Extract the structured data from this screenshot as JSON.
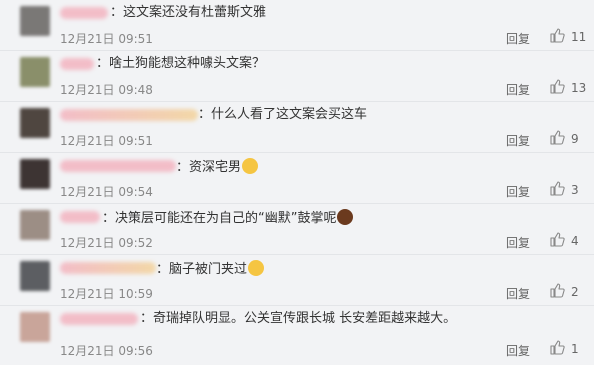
{
  "reply_label": "回复",
  "comments": [
    {
      "text": "：这文案还没有杜蕾斯文雅",
      "time": "12月21日 09:51",
      "likes": "11"
    },
    {
      "text": "：啥土狗能想这种噱头文案？",
      "time": "12月21日 09:48",
      "likes": "13"
    },
    {
      "text": "：什么人看了这文案会买这车",
      "time": "12月21日 09:51",
      "likes": "9"
    },
    {
      "text": "：资深宅男",
      "time": "12月21日 09:54",
      "likes": "3"
    },
    {
      "text": "：决策层可能还在为自己的“幽默”鼓掌呢",
      "time": "12月21日 09:52",
      "likes": "4"
    },
    {
      "text": "：脑子被门夹过",
      "time": "12月21日 10:59",
      "likes": "2"
    },
    {
      "text": "：奇瑞掉队明显。公关宣传跟长城 长安差距越来越大。",
      "time": "12月21日 09:56",
      "likes": "1"
    }
  ],
  "colors": {
    "emoji_face": "#f5c542",
    "emoji_dark": "#6b3a1e",
    "avatar_1": "#7a7876",
    "avatar_2": "#8a8f6a",
    "avatar_3": "#4f4640",
    "avatar_4": "#3d3433",
    "avatar_5": "#9c8e85",
    "avatar_6": "#5c5e62",
    "avatar_7": "#c9a59a",
    "name_pink": "#f3b4c0",
    "name_yellow": "#f3d39a"
  }
}
